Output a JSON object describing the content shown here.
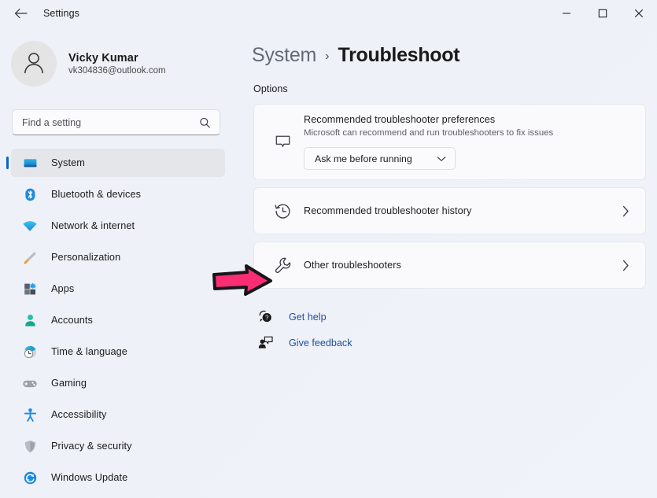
{
  "window": {
    "title": "Settings",
    "back_icon": "arrow-left-icon",
    "controls": {
      "minimize": "minimize-icon",
      "maximize": "maximize-icon",
      "close": "close-icon"
    }
  },
  "account": {
    "name": "Vicky Kumar",
    "email": "vk304836@outlook.com",
    "avatar_icon": "person-avatar-icon"
  },
  "search": {
    "placeholder": "Find a setting",
    "value": "",
    "icon": "search-icon"
  },
  "sidebar": {
    "items": [
      {
        "label": "System",
        "icon": "monitor-icon",
        "selected": true
      },
      {
        "label": "Bluetooth & devices",
        "icon": "bluetooth-icon",
        "selected": false
      },
      {
        "label": "Network & internet",
        "icon": "wifi-icon",
        "selected": false
      },
      {
        "label": "Personalization",
        "icon": "paintbrush-icon",
        "selected": false
      },
      {
        "label": "Apps",
        "icon": "apps-grid-icon",
        "selected": false
      },
      {
        "label": "Accounts",
        "icon": "person-icon",
        "selected": false
      },
      {
        "label": "Time & language",
        "icon": "clock-globe-icon",
        "selected": false
      },
      {
        "label": "Gaming",
        "icon": "gamepad-icon",
        "selected": false
      },
      {
        "label": "Accessibility",
        "icon": "accessibility-person-icon",
        "selected": false
      },
      {
        "label": "Privacy & security",
        "icon": "shield-icon",
        "selected": false
      },
      {
        "label": "Windows Update",
        "icon": "update-refresh-icon",
        "selected": false
      }
    ]
  },
  "main": {
    "breadcrumb": {
      "root": "System",
      "separator": "›",
      "current": "Troubleshoot"
    },
    "section_title": "Options",
    "cards": [
      {
        "icon": "chat-bubble-icon",
        "title": "Recommended troubleshooter preferences",
        "subtitle": "Microsoft can recommend and run troubleshooters to fix issues",
        "dropdown": {
          "value": "Ask me before running",
          "chevron": "chevron-down-icon"
        }
      },
      {
        "icon": "history-clock-icon",
        "title": "Recommended troubleshooter history",
        "chevron": "chevron-right-icon"
      },
      {
        "icon": "wrench-icon",
        "title": "Other troubleshooters",
        "chevron": "chevron-right-icon"
      }
    ],
    "links": [
      {
        "label": "Get help",
        "icon": "help-question-icon"
      },
      {
        "label": "Give feedback",
        "icon": "feedback-person-icon"
      }
    ]
  },
  "annotation": {
    "arrow_icon": "pink-pointer-arrow",
    "color": "#fa2d73",
    "outline_color": "#16161a"
  },
  "colors": {
    "page_background": "#eef1f8",
    "card_background": "#fafafc",
    "accent": "#0a65c7",
    "link": "#1f4f9c",
    "sidebar_selected": "#e4e6ea"
  }
}
